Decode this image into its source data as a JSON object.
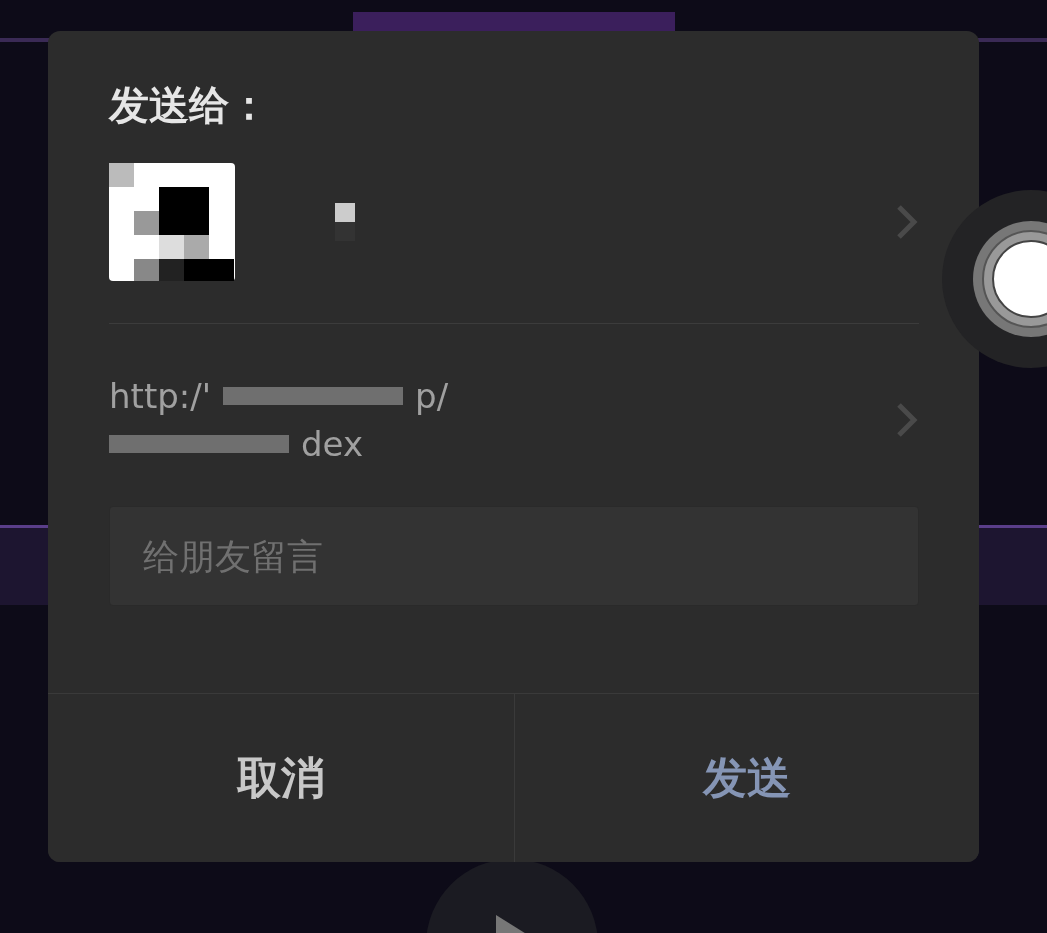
{
  "dialog": {
    "title": "发送给：",
    "recipient": {
      "name_redacted": true
    },
    "link": {
      "lines": [
        [
          {
            "kind": "text",
            "text": "http:/'"
          },
          {
            "kind": "redacted"
          },
          {
            "kind": "text",
            "text": "p/"
          }
        ],
        [
          {
            "kind": "redacted"
          },
          {
            "kind": "text",
            "text": "dex"
          }
        ]
      ]
    },
    "message": {
      "placeholder": "给朋友留言"
    },
    "buttons": [
      {
        "label": "取消",
        "kind": "cancel"
      },
      {
        "label": "发送",
        "kind": "primary"
      }
    ]
  }
}
